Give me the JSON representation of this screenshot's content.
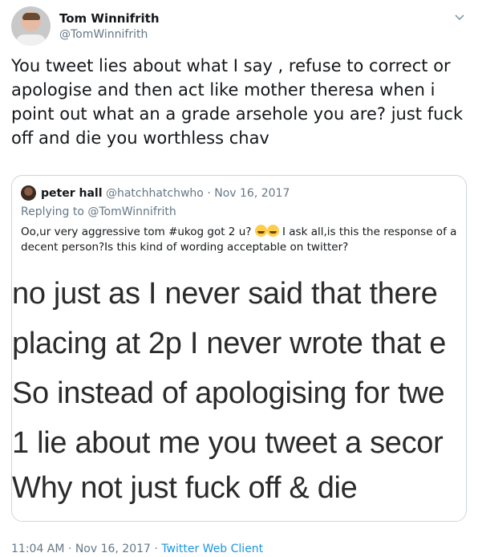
{
  "author": {
    "name": "Tom Winnifrith",
    "handle": "@TomWinnifrith"
  },
  "tweet": {
    "text": "You tweet lies about what I say , refuse to correct or apologise and then act like mother theresa when i point out what an a grade arsehole you are? just fuck off and die you worthless chav"
  },
  "quoted": {
    "name": "peter hall",
    "handle": "@hatchhatchwho",
    "separator": "·",
    "date": "Nov 16, 2017",
    "replying_to": "Replying to @TomWinnifrith",
    "text_before": "Oo,ur very aggressive tom #ukog got 2 u? ",
    "text_after": "I ask all,is this the response of a decent person?Is this kind of wording acceptable on twitter?",
    "emojis": [
      "rolling-on-floor-laughing-emoji",
      "tears-of-joy-emoji"
    ],
    "image_lines": [
      "no just as I never said that there",
      "placing at 2p I never wrote that e",
      "So instead of apologising for twe",
      "1 lie about me you tweet a secor",
      "Why not just fuck off & die"
    ]
  },
  "footer": {
    "time": "11:04 AM",
    "sep1": "·",
    "date": "Nov 16, 2017",
    "sep2": "·",
    "client": "Twitter Web Client"
  },
  "icons": {
    "menu": "chevron-down-icon"
  },
  "colors": {
    "link": "#1b95e0",
    "muted": "#657786",
    "text": "#14171a",
    "border": "#ccd6dd"
  }
}
